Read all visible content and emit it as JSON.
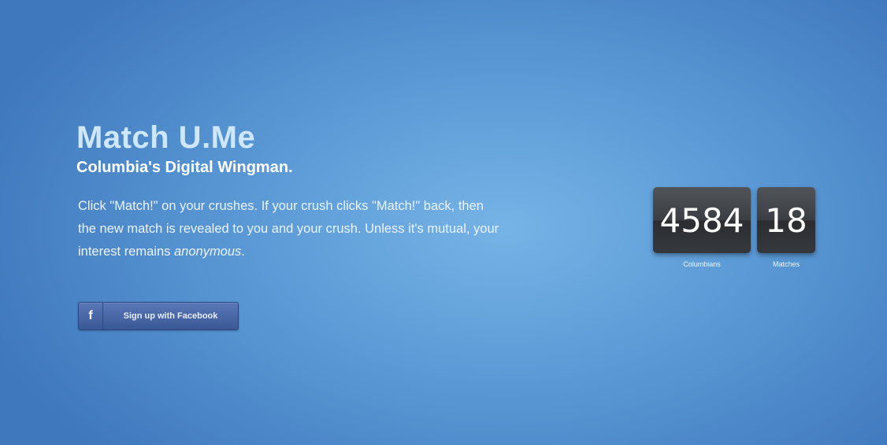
{
  "hero": {
    "title": "Match U.Me",
    "tagline": "Columbia's Digital Wingman.",
    "description_main": "Click \"Match!\" on your crushes. If your crush clicks \"Match!\" back, then the new match is revealed to you and your crush. Unless it's mutual, your interest remains",
    "description_emphasis": "anonymous",
    "description_end": "."
  },
  "signup": {
    "icon": "facebook-icon",
    "icon_glyph": "f",
    "label": "Sign up with Facebook"
  },
  "stats": [
    {
      "value": "4584",
      "label": "Columbians"
    },
    {
      "value": "18",
      "label": "Matches"
    }
  ],
  "colors": {
    "background": "#5b9ad6",
    "button": "#3b5998",
    "counter": "#3b3e43"
  }
}
